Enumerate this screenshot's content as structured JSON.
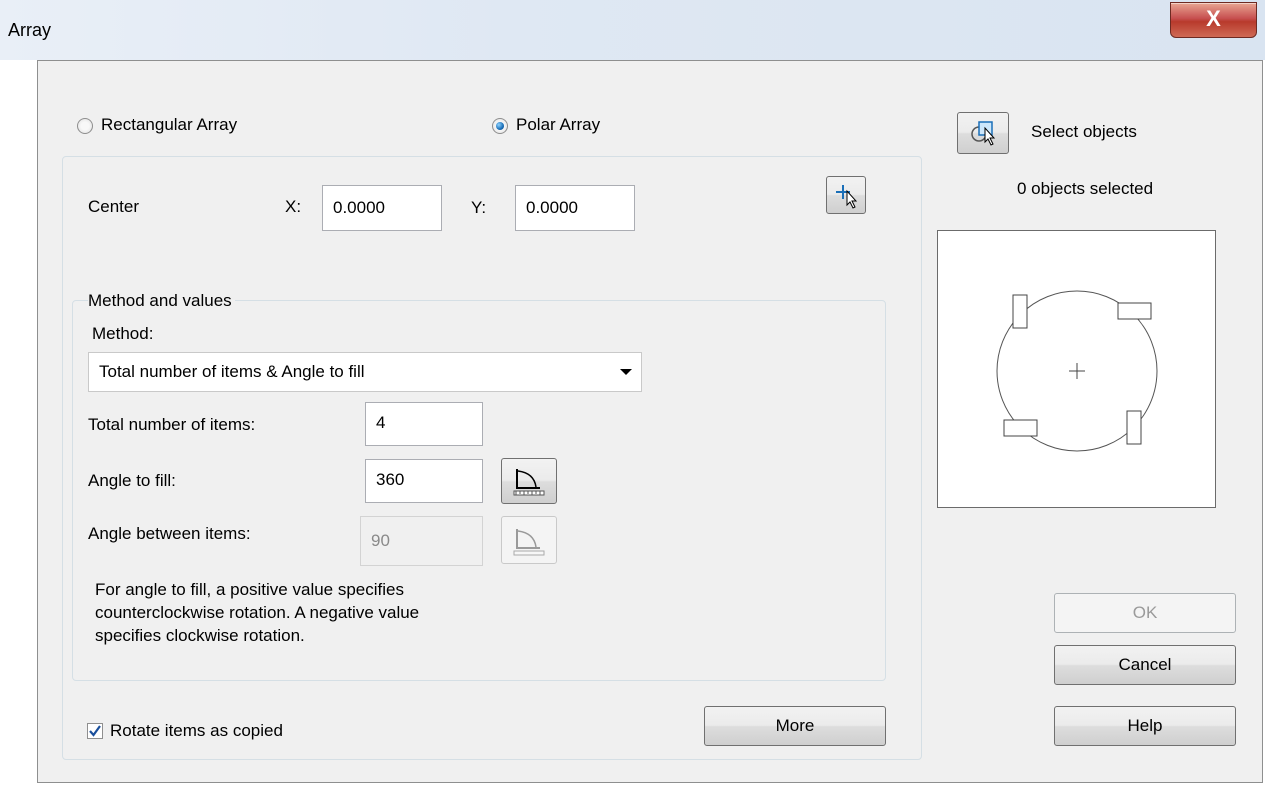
{
  "window": {
    "title": "Array",
    "close_glyph": "X"
  },
  "array_type": {
    "rectangular_label": "Rectangular Array",
    "polar_label": "Polar Array",
    "selected": "Polar Array"
  },
  "center": {
    "label": "Center",
    "x_label": "X:",
    "x_value": "0.0000",
    "y_label": "Y:",
    "y_value": "0.0000",
    "pick_icon": "pick-point-icon"
  },
  "method_group": {
    "title": "Method and values",
    "method_label": "Method:",
    "method_value": "Total number of items & Angle to fill",
    "total_items_label": "Total number of items:",
    "total_items_value": "4",
    "angle_fill_label": "Angle to fill:",
    "angle_fill_value": "360",
    "angle_between_label": "Angle between items:",
    "angle_between_value": "90",
    "angle_icon": "pick-angle-icon",
    "note_line1": "For angle to fill, a positive value specifies",
    "note_line2": "counterclockwise rotation. A negative value",
    "note_line3": "specifies clockwise rotation."
  },
  "rotate_checkbox": {
    "label": "Rotate items as copied",
    "checked": true
  },
  "more_button": "More",
  "selection": {
    "select_label": "Select objects",
    "select_icon": "select-objects-icon",
    "count_text": "0 objects selected"
  },
  "buttons": {
    "ok": "OK",
    "cancel": "Cancel",
    "help": "Help"
  },
  "colors": {
    "accent": "#1a6fb8",
    "close": "#c75050",
    "frame_bg": "#f0f0f0"
  }
}
